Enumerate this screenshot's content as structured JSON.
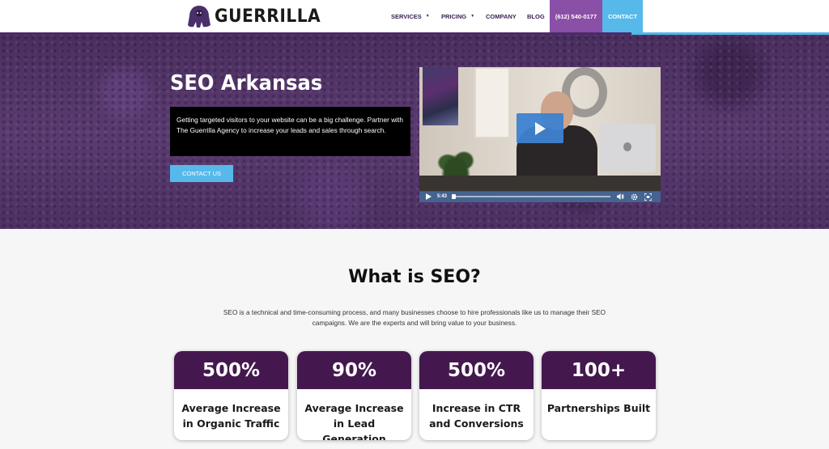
{
  "brand": {
    "logo_text": "GUERRILLA",
    "accent_purple": "#44184f",
    "accent_blue": "#56b9ea"
  },
  "nav": {
    "items": [
      {
        "label": "SERVICES",
        "has_dropdown": true
      },
      {
        "label": "PRICING",
        "has_dropdown": true
      },
      {
        "label": "COMPANY",
        "has_dropdown": false
      },
      {
        "label": "BLOG",
        "has_dropdown": false
      }
    ],
    "phone": "(612) 540-0177",
    "contact": "CONTACT"
  },
  "hero": {
    "title": "SEO Arkansas",
    "description": "Getting targeted visitors to your website can be a big challenge. Partner with The Guerrilla Agency to increase your leads and sales through search.",
    "cta": "CONTACT US",
    "video": {
      "time": "5:43",
      "icons": [
        "play-icon",
        "volume-icon",
        "settings-icon",
        "fullscreen-icon"
      ]
    }
  },
  "about": {
    "title": "What is SEO?",
    "description": "SEO is a technical and time-consuming process, and many businesses choose to hire professionals like us to manage their SEO campaigns. We are the experts and will bring value to your business."
  },
  "stats": [
    {
      "value": "500%",
      "label": "Average Increase in Organic Traffic"
    },
    {
      "value": "90%",
      "label": "Average Increase in Lead Generation"
    },
    {
      "value": "500%",
      "label": "Increase in CTR and Conversions"
    },
    {
      "value": "100+",
      "label": "Partnerships Built"
    }
  ]
}
